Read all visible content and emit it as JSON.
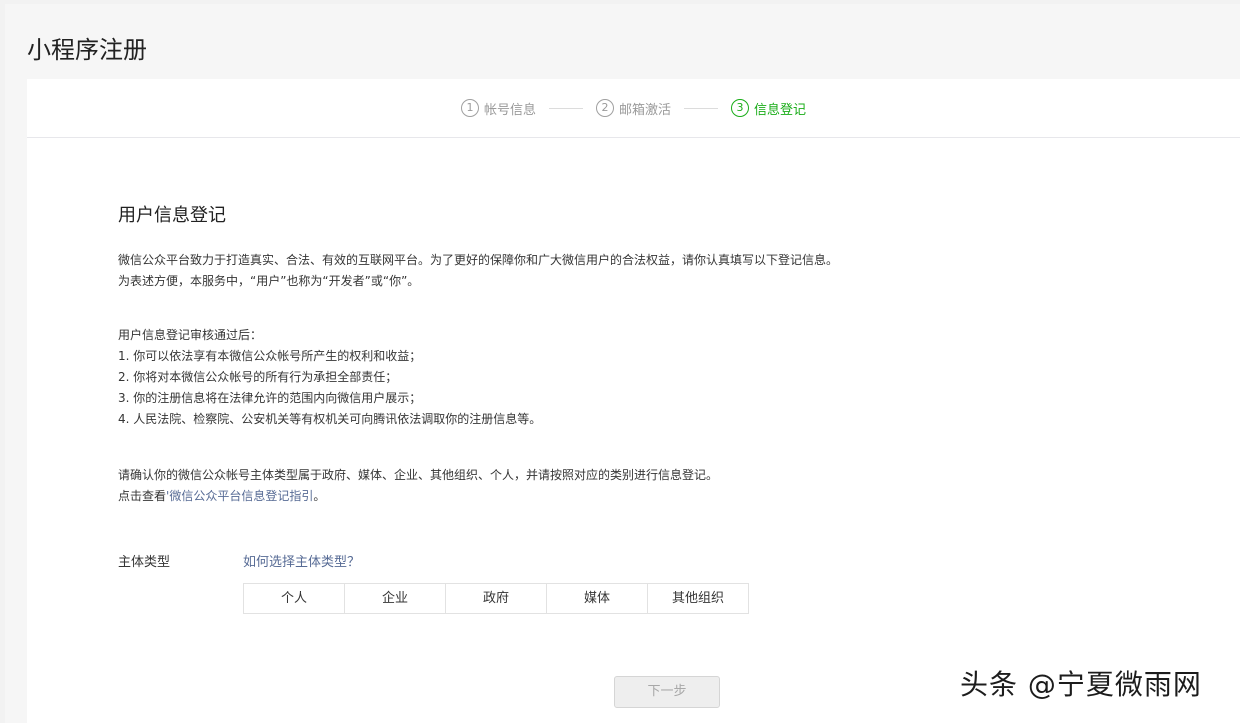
{
  "page": {
    "title": "小程序注册"
  },
  "steps": [
    {
      "num": "1",
      "label": "帐号信息",
      "active": false
    },
    {
      "num": "2",
      "label": "邮箱激活",
      "active": false
    },
    {
      "num": "3",
      "label": "信息登记",
      "active": true
    }
  ],
  "section": {
    "title": "用户信息登记",
    "intro": [
      "微信公众平台致力于打造真实、合法、有效的互联网平台。为了更好的保障你和广大微信用户的合法权益，请你认真填写以下登记信息。",
      "为表述方便，本服务中，“用户”也称为“开发者”或“你”。"
    ],
    "benefits": [
      "用户信息登记审核通过后：",
      "1. 你可以依法享有本微信公众帐号所产生的权利和收益；",
      "2. 你将对本微信公众帐号的所有行为承担全部责任；",
      "3. 你的注册信息将在法律允许的范围内向微信用户展示；",
      "4. 人民法院、检察院、公安机关等有权机关可向腾讯依法调取你的注册信息等。"
    ],
    "confirm_line": "请确认你的微信公众帐号主体类型属于政府、媒体、企业、其他组织、个人，并请按照对应的类别进行信息登记。",
    "guide_prefix": "点击查看",
    "guide_link": "'微信公众平台信息登记指引",
    "guide_suffix": "。"
  },
  "entity_type": {
    "label": "主体类型",
    "help_link": "如何选择主体类型？",
    "options": [
      "个人",
      "企业",
      "政府",
      "媒体",
      "其他组织"
    ]
  },
  "next_button": {
    "label": "下一步",
    "enabled": false
  },
  "watermark": "头条 @宁夏微雨网",
  "colors": {
    "active_step": "#1aad19",
    "link": "#576b95"
  }
}
